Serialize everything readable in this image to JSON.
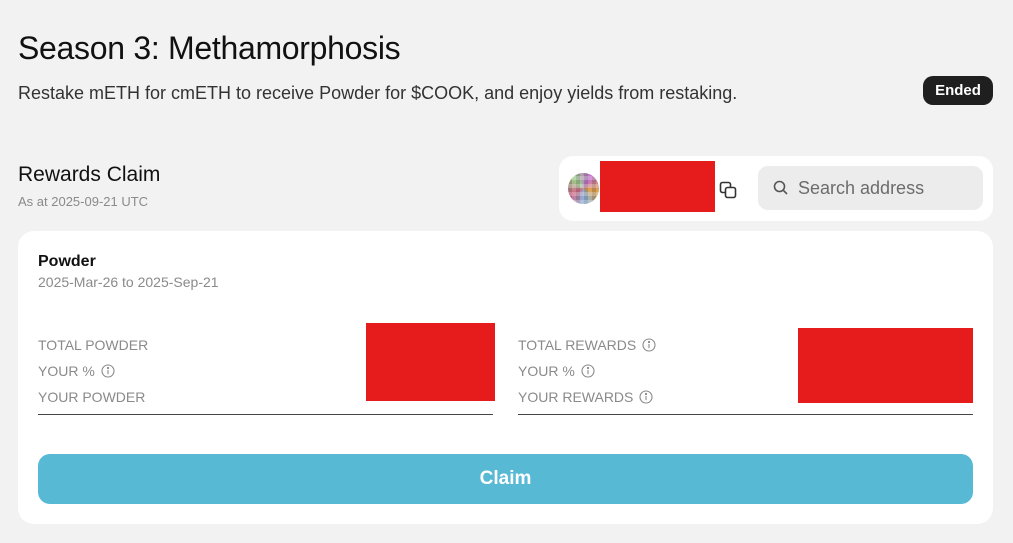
{
  "header": {
    "title": "Season 3: Methamorphosis",
    "subtitle": "Restake mETH for cmETH to receive Powder for $COOK, and enjoy yields from restaking.",
    "status_badge": "Ended"
  },
  "rewards_claim": {
    "title": "Rewards Claim",
    "as_at": "As at 2025-09-21 UTC"
  },
  "address_panel": {
    "search_placeholder": "Search address",
    "icons": [
      "avatar",
      "copy-icon",
      "search-icon"
    ]
  },
  "card": {
    "title": "Powder",
    "date_range": "2025-Mar-26 to 2025-Sep-21",
    "left_stats": [
      {
        "label": "TOTAL POWDER"
      },
      {
        "label": "YOUR %"
      },
      {
        "label": "YOUR POWDER"
      }
    ],
    "right_stats": [
      {
        "label": "TOTAL REWARDS"
      },
      {
        "label": "YOUR %"
      },
      {
        "label": "YOUR REWARDS"
      }
    ],
    "claim_label": "Claim"
  },
  "colors": {
    "background": "#f2f2f2",
    "card": "#ffffff",
    "claim_button": "#57b9d4",
    "badge": "#1f1f1f",
    "redaction": "#e61c1c"
  }
}
